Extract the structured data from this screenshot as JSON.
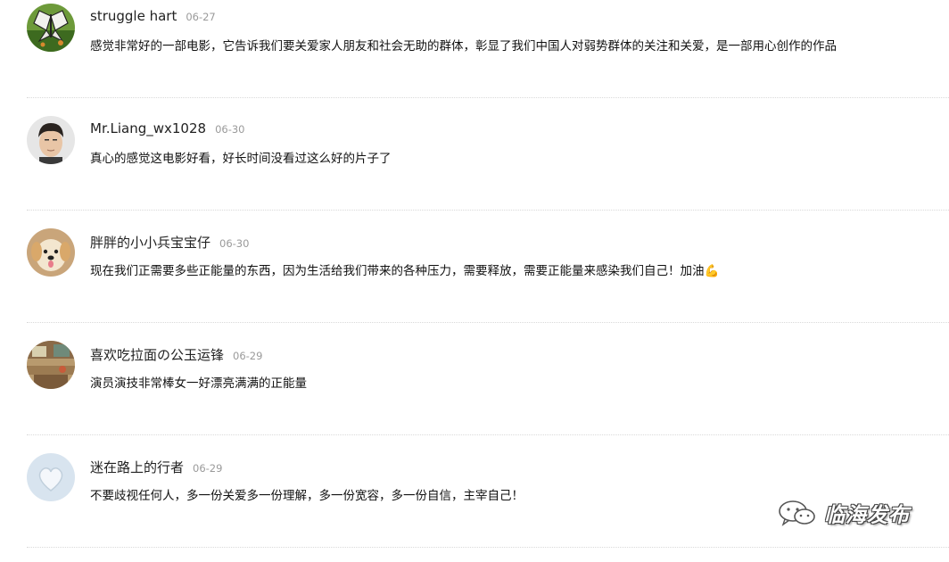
{
  "comments": [
    {
      "name": "struggle hart",
      "date": "06-27",
      "text": "感觉非常好的一部电影，它告诉我们要关爱家人朋友和社会无助的群体，彰显了我们中国人对弱势群体的关注和关爱，是一部用心创作的作品",
      "avatar": "butterfly-avatar"
    },
    {
      "name": "Mr.Liang_wx1028",
      "date": "06-30",
      "text": "真心的感觉这电影好看，好长时间没看过这么好的片子了",
      "avatar": "man-portrait-avatar"
    },
    {
      "name": "胖胖的小小兵宝宝仔",
      "date": "06-30",
      "text": "现在我们正需要多些正能量的东西，因为生活给我们带来的各种压力，需要释放，需要正能量来感染我们自己！加油💪",
      "avatar": "puppy-avatar"
    },
    {
      "name": "喜欢吃拉面の公玉运锋",
      "date": "06-29",
      "text": "演员演技非常棒女一好漂亮满满的正能量",
      "avatar": "room-photo-avatar"
    },
    {
      "name": "迷在路上的行者",
      "date": "06-29",
      "text": "不要歧视任何人，多一份关爱多一份理解，多一份宽容，多一份自信，主宰自己！",
      "avatar": "heart-avatar"
    }
  ],
  "watermark": {
    "text": "临海发布",
    "icon": "wechat-icon"
  }
}
